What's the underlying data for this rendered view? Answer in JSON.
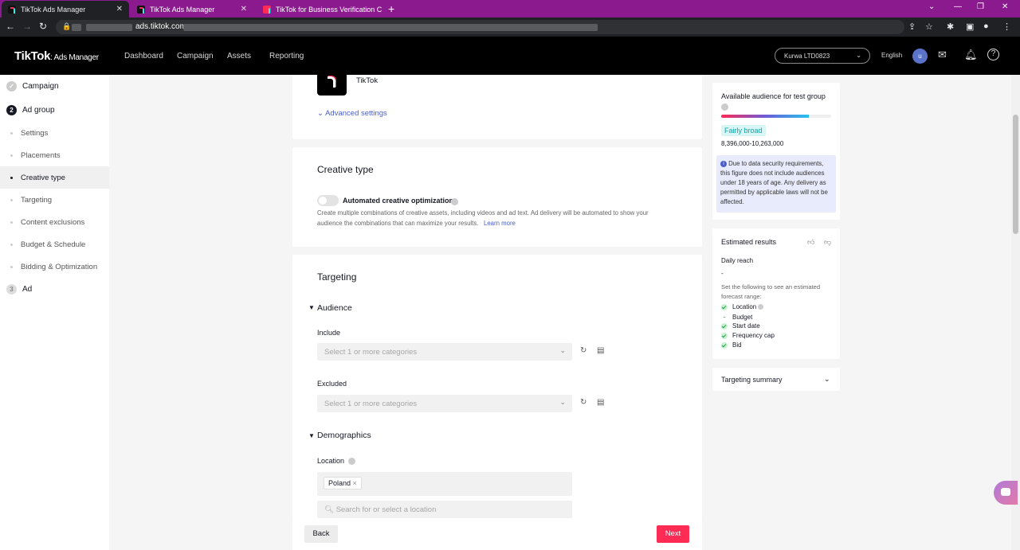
{
  "browser": {
    "tabs": [
      {
        "title": "TikTok Ads Manager"
      },
      {
        "title": "TikTok Ads Manager"
      },
      {
        "title": "TikTok for Business Verification C"
      }
    ],
    "url": "ads.tiktok.com"
  },
  "header": {
    "logo_main": "TikTok",
    "logo_sub": ": Ads Manager",
    "nav": [
      "Dashboard",
      "Campaign",
      "Assets",
      "Reporting"
    ],
    "account": "Kurwa LTD0823",
    "language": "English",
    "avatar_initial": "u"
  },
  "sidebar": {
    "campaign": "Campaign",
    "adgroup_num": "2",
    "adgroup": "Ad group",
    "items": [
      "Settings",
      "Placements",
      "Creative type",
      "Targeting",
      "Content exclusions",
      "Budget & Schedule",
      "Bidding & Optimization"
    ],
    "ad_num": "3",
    "ad": "Ad"
  },
  "identity": {
    "name": "TikTok",
    "advanced": "Advanced settings"
  },
  "creative": {
    "title": "Creative type",
    "toggle_label": "Automated creative optimization",
    "desc_1": "Create multiple combinations of creative assets, including videos and ad text. Ad delivery will be automated to show your",
    "desc_2": "audience the combinations that can maximize your results.",
    "learn_more": "Learn more"
  },
  "targeting": {
    "title": "Targeting",
    "audience": "Audience",
    "include": "Include",
    "include_placeholder": "Select 1 or more categories",
    "excluded": "Excluded",
    "excluded_placeholder": "Select 1 or more categories",
    "demographics": "Demographics",
    "location": "Location",
    "location_chip": "Poland",
    "location_search": "Search for or select a location"
  },
  "footer": {
    "back": "Back",
    "next": "Next"
  },
  "audience_panel": {
    "title": "Available audience for test group",
    "level": 0.8,
    "badge": "Fairly broad",
    "range": "8,396,000-10,263,000",
    "notice": "Due to data security requirements, this figure does not include audiences under 18 years of age. Any delivery as permitted by applicable laws will not be affected."
  },
  "estimated": {
    "title": "Estimated results",
    "daily_reach": "Daily reach",
    "reach_value": "-",
    "hint": "Set the following to see an estimated forecast range:",
    "checklist": [
      "Location",
      "Budget",
      "Start date",
      "Frequency cap",
      "Bid"
    ]
  },
  "summary": {
    "title": "Targeting summary"
  },
  "colors": {
    "accent": "#fe2c55",
    "link": "#4a5ec8"
  }
}
